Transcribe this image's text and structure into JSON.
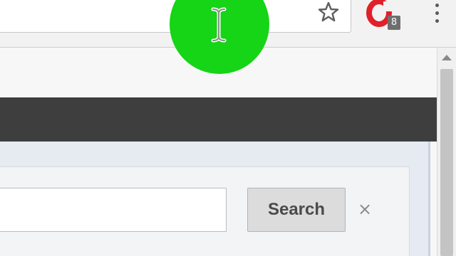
{
  "browser": {
    "address_bar_value": "",
    "bookmark_icon": "star-outline-icon",
    "extension_icon": "opera-icon",
    "extension_badge": "8",
    "menu_icon": "vertical-dots-icon"
  },
  "search": {
    "input_value": "",
    "button_label": "Search",
    "close_label": "×"
  },
  "cursor": {
    "type": "text-cursor",
    "highlight_color": "#16d416"
  },
  "colors": {
    "toolbar": "#f2f2f2",
    "dark_bar": "#3e3e3e",
    "panel": "#e6ebf1",
    "button": "#dcdcdc",
    "extension_red": "#e0202a"
  }
}
